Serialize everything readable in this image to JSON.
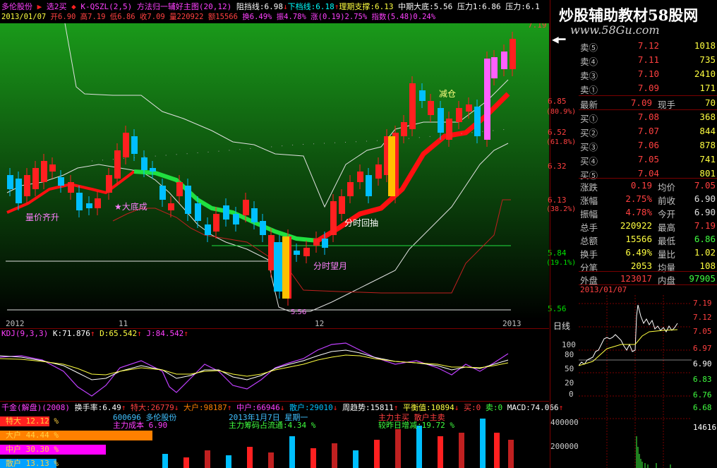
{
  "header": {
    "stock_name": "多伦股份",
    "indicator_name": "选2买",
    "indicator_line": "K-QSZL(2,5) 方法归一辅好主图(20,12)",
    "resistance_line": "阻挡线:6.98",
    "lower_line": "下档线:6.18",
    "support": "理期支撑:6.13",
    "mid_bottom": "中期大底:5.56",
    "pressure1": "压力1:6.86",
    "pressure": "压力:6.1",
    "date": "2013/01/07",
    "open": "开6.90",
    "high": "高7.19",
    "low": "低6.86",
    "close": "收7.09",
    "volume": "量220922",
    "amount": "额15566",
    "turnover": "换6.49%",
    "amplitude": "振4.78%",
    "change": "涨(0.19)2.75%",
    "index": "指数(5.48)0.24%"
  },
  "main_chart": {
    "y_labels": [
      "7.19",
      "6.85",
      "(80.9%)",
      "6.52",
      "(61.8%)",
      "6.32",
      "6.13",
      "(38.2%)",
      "5.84",
      "(19.1%)",
      "5.56"
    ],
    "x_labels": [
      "2012",
      "11",
      "12",
      "2013"
    ],
    "low_marker": "5.56",
    "annotations": [
      "量价齐升",
      "★大底成",
      "分时回抽",
      "分时望月",
      "减仓"
    ],
    "colors": {
      "bull": "#ff2020",
      "bear": "#00bfff",
      "ribbon_up": "#ff0000",
      "ribbon_down": "#20e040",
      "gradient_top": "#1a9a1a",
      "gradient_bottom": "#000000"
    }
  },
  "kdj": {
    "title": "KDJ(9,3,3)",
    "k": "K:71.876",
    "d": "D:65.542",
    "j": "J:84.542",
    "y_labels": [
      "100",
      "80",
      "50",
      "20",
      "0"
    ]
  },
  "volume_panel": {
    "title_line": "千金(解盘)(2008)",
    "turnover": "换手率:6.49",
    "super_large": "特大:26779",
    "large": "大户:98187",
    "medium": "中户:66946",
    "retail": "散户:29010",
    "trend": "周趋势:15811",
    "balance": "平衡值:10894",
    "buy": "买:0",
    "sell": "卖:0",
    "macd": "MACD:74.066",
    "bars": [
      {
        "label": "特大 12.12 %",
        "color": "#ff2020",
        "value": 12.12
      },
      {
        "label": "大户 44.44 %",
        "color": "#ff8000",
        "value": 44.44
      },
      {
        "label": "中户 30.30 %",
        "color": "#ff00ff",
        "value": 30.3
      },
      {
        "label": "散户 13.13 %",
        "color": "#00a0ff",
        "value": 13.13
      }
    ],
    "info1": "600696 多伦股份",
    "info2": "主力成本 6.90",
    "info3": "2013年1月7日 星期一",
    "info4": "主力筹码占流通:4.34 %",
    "info5": "主力主买  散户主卖",
    "info6": "较昨日增减:19.72 %",
    "y_labels": [
      "400000",
      "200000"
    ]
  },
  "watermark": {
    "text": "炒股辅助教材",
    "brand": "58股网",
    "url": "www.58Gu.com"
  },
  "quotes": {
    "asks": [
      {
        "label": "卖⑤",
        "price": "7.12",
        "volume": "1018"
      },
      {
        "label": "卖④",
        "price": "7.11",
        "volume": "735"
      },
      {
        "label": "卖③",
        "price": "7.10",
        "volume": "2410"
      },
      {
        "label": "卖①",
        "price": "7.09",
        "volume": "171"
      }
    ],
    "latest_label": "最新",
    "latest": "7.09",
    "now_hand_label": "现手",
    "now_hand": "70",
    "bids": [
      {
        "label": "买①",
        "price": "7.08",
        "volume": "368"
      },
      {
        "label": "买②",
        "price": "7.07",
        "volume": "844"
      },
      {
        "label": "买③",
        "price": "7.06",
        "volume": "878"
      },
      {
        "label": "买④",
        "price": "7.05",
        "volume": "741"
      },
      {
        "label": "买⑤",
        "price": "7.04",
        "volume": "801"
      }
    ]
  },
  "stats": [
    {
      "k1": "涨跌",
      "v1": "0.19",
      "c1": "red",
      "k2": "均价",
      "v2": "7.05",
      "c2": "red"
    },
    {
      "k1": "涨幅",
      "v1": "2.75%",
      "c1": "red",
      "k2": "前收",
      "v2": "6.90",
      "c2": "wht"
    },
    {
      "k1": "振幅",
      "v1": "4.78%",
      "c1": "red",
      "k2": "今开",
      "v2": "6.90",
      "c2": "wht"
    },
    {
      "k1": "总手",
      "v1": "220922",
      "c1": "yel",
      "k2": "最高",
      "v2": "7.19",
      "c2": "red"
    },
    {
      "k1": "总额",
      "v1": "15566",
      "c1": "yel",
      "k2": "最低",
      "v2": "6.86",
      "c2": "grn"
    },
    {
      "k1": "换手",
      "v1": "6.49%",
      "c1": "yel",
      "k2": "量比",
      "v2": "1.02",
      "c2": "yel"
    },
    {
      "k1": "分笔",
      "v1": "2053",
      "c1": "yel",
      "k2": "均量",
      "v2": "108",
      "c2": "yel"
    }
  ],
  "outer_inner": {
    "outer_label": "外盘",
    "outer": "123017",
    "inner_label": "内盘",
    "inner": "97905"
  },
  "intraday": {
    "date": "2013/01/07",
    "y_labels": [
      "7.19",
      "7.12",
      "7.05",
      "6.97",
      "6.90",
      "6.83",
      "6.76",
      "6.68"
    ],
    "vol_label": "14616",
    "period": "日线"
  }
}
